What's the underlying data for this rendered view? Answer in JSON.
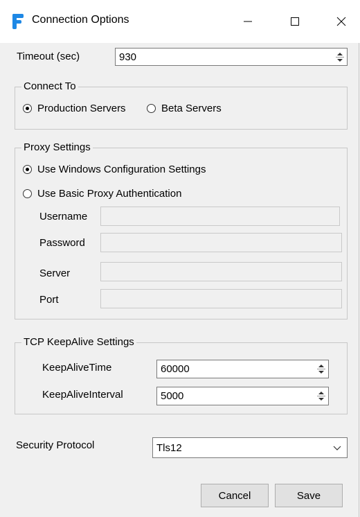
{
  "window": {
    "title": "Connection Options",
    "logo_icon": "app-logo-icon",
    "accent_color": "#1e88e5"
  },
  "timeout": {
    "label": "Timeout (sec)",
    "value": "930"
  },
  "connect_to": {
    "legend": "Connect To",
    "options": [
      {
        "label": "Production Servers",
        "selected": true
      },
      {
        "label": "Beta Servers",
        "selected": false
      }
    ]
  },
  "proxy": {
    "legend": "Proxy Settings",
    "options": [
      {
        "label": "Use Windows Configuration Settings",
        "selected": true
      },
      {
        "label": "Use Basic Proxy Authentication",
        "selected": false
      }
    ],
    "fields": [
      {
        "label": "Username",
        "value": ""
      },
      {
        "label": "Password",
        "value": ""
      },
      {
        "label": "Server",
        "value": ""
      },
      {
        "label": "Port",
        "value": ""
      }
    ]
  },
  "keepalive": {
    "legend": "TCP KeepAlive Settings",
    "time_label": "KeepAliveTime",
    "time_value": "60000",
    "interval_label": "KeepAliveInterval",
    "interval_value": "5000"
  },
  "security": {
    "label": "Security Protocol",
    "value": "Tls12"
  },
  "buttons": {
    "cancel": "Cancel",
    "save": "Save"
  }
}
